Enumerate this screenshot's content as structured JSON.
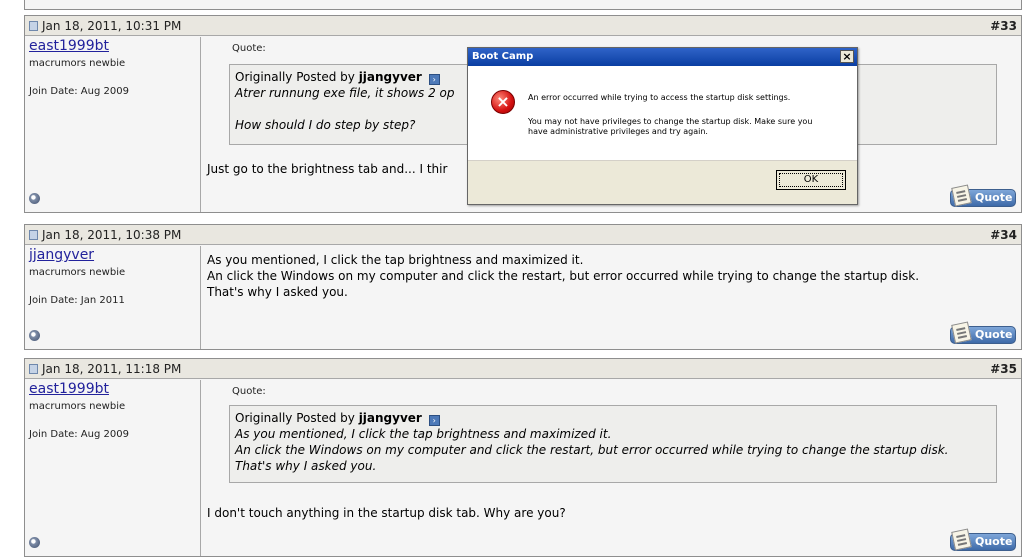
{
  "posts": [
    {
      "date": "Jan 18, 2011, 10:31 PM",
      "number": "#33",
      "username": "east1999bt",
      "usertitle": "macrumors newbie",
      "joindate": "Join Date: Aug 2009",
      "quote_label": "Quote:",
      "quote_prefix": "Originally Posted by",
      "quote_author": "jjangyver",
      "quote_lines": [
        "Atrer runnung exe file, it shows 2 op",
        "",
        "How should I do step by step?"
      ],
      "body_lines": [
        "Just go to the brightness tab and... I thir"
      ],
      "quote_button": "Quote"
    },
    {
      "date": "Jan 18, 2011, 10:38 PM",
      "number": "#34",
      "username": "jjangyver",
      "usertitle": "macrumors newbie",
      "joindate": "Join Date: Jan 2011",
      "body_lines": [
        "As you mentioned, I click the tap brightness and maximized it.",
        "An click the Windows on my computer and click the restart, but error occurred while trying to change the startup disk.",
        "That's why I asked you."
      ],
      "quote_button": "Quote"
    },
    {
      "date": "Jan 18, 2011, 11:18 PM",
      "number": "#35",
      "username": "east1999bt",
      "usertitle": "macrumors newbie",
      "joindate": "Join Date: Aug 2009",
      "quote_label": "Quote:",
      "quote_prefix": "Originally Posted by",
      "quote_author": "jjangyver",
      "quote_lines": [
        "As you mentioned, I click the tap brightness and maximized it.",
        "An click the Windows on my computer and click the restart, but error occurred while trying to change the startup disk.",
        "That's why I asked you."
      ],
      "body_lines": [
        "I don't touch anything in the startup disk tab. Why are you?"
      ],
      "quote_button": "Quote"
    }
  ],
  "dialog": {
    "title": "Boot Camp",
    "close_glyph": "×",
    "icon": "error-icon",
    "message1": "An error occurred while trying to access the startup disk settings.",
    "message2": "You may not have privileges to change the startup disk. Make sure you have administrative privileges and try again.",
    "ok_label": "OK"
  }
}
